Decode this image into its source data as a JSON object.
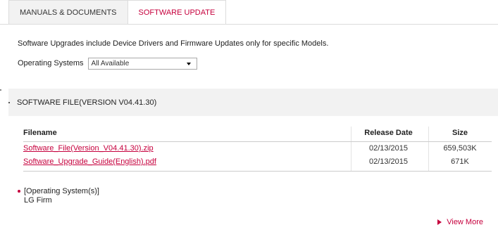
{
  "tabs": [
    {
      "label": "MANUALS & DOCUMENTS",
      "active": false
    },
    {
      "label": "SOFTWARE UPDATE",
      "active": true
    }
  ],
  "intro_text": "Software Upgrades include Device Drivers and Firmware Updates only for specific Models.",
  "os_filter": {
    "label": "Operating Systems",
    "selected": "All Available"
  },
  "file_section": {
    "title": "SOFTWARE FILE(VERSION V04.41.30)"
  },
  "table": {
    "headers": {
      "filename": "Filename",
      "release_date": "Release Date",
      "size": "Size"
    },
    "rows": [
      {
        "filename": "Software_File(Version_V04.41.30).zip",
        "release_date": "02/13/2015",
        "size": "659,503K"
      },
      {
        "filename": "Software_Upgrade_Guide(English).pdf",
        "release_date": "02/13/2015",
        "size": "671K"
      }
    ]
  },
  "os_info": {
    "label": "[Operating System(s)]",
    "value": "LG Firm"
  },
  "view_more": {
    "label": "View More"
  },
  "colors": {
    "accent": "#c6003d",
    "panel": "#f2f2f2",
    "border": "#dcdcdc"
  },
  "icons": {
    "select_arrow": "chevron-down-icon",
    "view_more": "triangle-right-icon",
    "os_bullet": "bullet-dot-icon"
  }
}
